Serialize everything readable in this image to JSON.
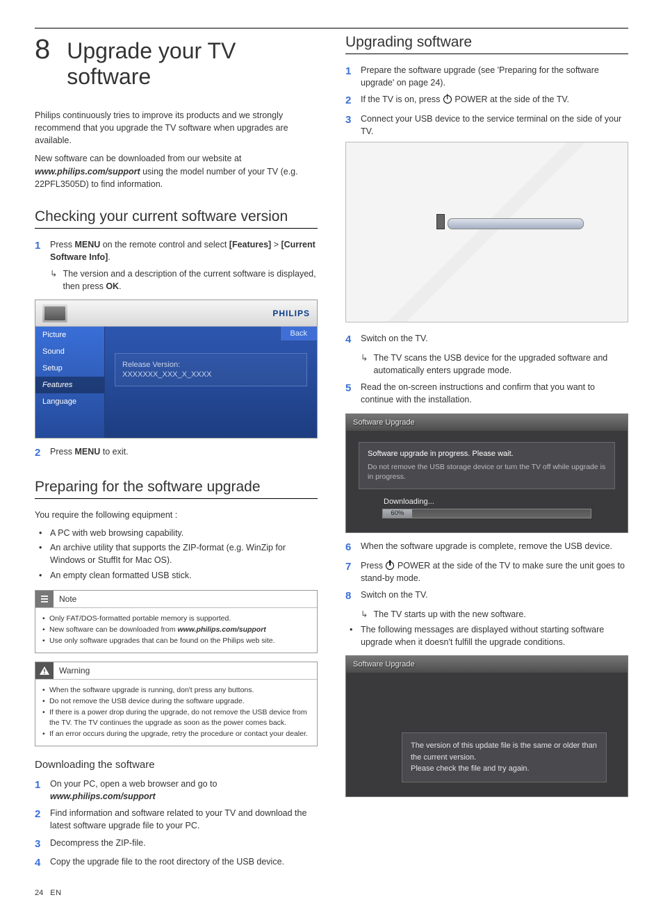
{
  "chapter": {
    "number": "8",
    "title": "Upgrade your TV software"
  },
  "left": {
    "intro1": "Philips continuously tries to improve its products and we strongly recommend that you upgrade the TV software when upgrades are available.",
    "intro2_a": "New software can be downloaded from our website at ",
    "intro2_url": "www.philips.com/support",
    "intro2_b": " using the model number of your TV (e.g. 22PFL3505D) to find information.",
    "sec1": {
      "heading": "Checking your current software version",
      "step1_a": "Press ",
      "step1_menu": "MENU",
      "step1_b": " on the remote control and select ",
      "step1_feat": "[Features]",
      "step1_gt": " > ",
      "step1_info": "[Current Software Info]",
      "step1_dot": ".",
      "step1_sub_a": "The version and a description of the current software is displayed, then press ",
      "step1_sub_ok": "OK",
      "step1_sub_b": ".",
      "step2_a": "Press ",
      "step2_menu": "MENU",
      "step2_b": " to exit."
    },
    "tvmenu": {
      "brand": "PHILIPS",
      "items": [
        "Picture",
        "Sound",
        "Setup",
        "Features",
        "Language"
      ],
      "back": "Back",
      "release_label": "Release Version:",
      "release_value": "XXXXXXX_XXX_X_XXXX"
    },
    "sec2": {
      "heading": "Preparing for the software upgrade",
      "intro": "You require the following equipment :",
      "bullets": [
        "A PC with web browsing capability.",
        "An archive utility that supports the ZIP-format (e.g. WinZip for Windows or StuffIt for Mac OS).",
        "An empty clean formatted USB stick."
      ],
      "note": {
        "label": "Note",
        "items_a": "Only FAT/DOS-formatted portable memory is supported.",
        "items_b_a": "New software can be downloaded from ",
        "items_b_url": "www.philips.com/support",
        "items_c": "Use only software upgrades that can be found on the Philips web site."
      },
      "warning": {
        "label": "Warning",
        "items": [
          "When the software upgrade is running, don't press any buttons.",
          "Do not remove the USB device during the software upgrade.",
          "If there is a power drop during the upgrade, do not remove the USB device from the TV. The TV continues the upgrade as soon as the power comes back.",
          "If an error occurs during the upgrade, retry the procedure or contact your dealer."
        ]
      },
      "dl_heading": "Downloading the software",
      "dl_step1_a": "On your PC, open a web browser and go to ",
      "dl_step1_url": "www.philips.com/support",
      "dl_step2": "Find information and software related to your TV and download the latest software upgrade file to your PC.",
      "dl_step3": "Decompress the ZIP-file.",
      "dl_step4": "Copy the upgrade file to the root directory of the USB device."
    }
  },
  "right": {
    "heading": "Upgrading software",
    "step1": "Prepare the software upgrade (see 'Preparing for the software upgrade' on page 24).",
    "step2_a": "If the TV is on, press ",
    "step2_b": " POWER at the side of the TV.",
    "step3": "Connect your USB device to the service terminal on the side of your TV.",
    "step4": "Switch on the TV.",
    "step4_sub": "The TV scans the USB device for the upgraded software and automatically enters upgrade mode.",
    "step5": "Read the on-screen instructions and confirm that you want to continue with the installation.",
    "sw_progress": {
      "title": "Software Upgrade",
      "line1": "Software upgrade in progress. Please wait.",
      "line2": "Do not remove the USB storage device or turn the TV off while upgrade is in progress.",
      "dl_label": "Downloading...",
      "percent": "60%"
    },
    "step6": "When the software upgrade is complete, remove the USB device.",
    "step7_a": "Press ",
    "step7_b": " POWER at the side of the TV to make sure the unit goes to stand-by mode.",
    "step8": "Switch on the TV.",
    "step8_sub": "The TV starts up with the new software.",
    "bullet_after": "The following messages are displayed without starting software upgrade when it doesn't fulfill the upgrade conditions.",
    "sw_fail": {
      "title": "Software Upgrade",
      "msg1": "The version of this update file is the same or older than the current version.",
      "msg2": "Please check the file and try again."
    }
  },
  "footer": {
    "page": "24",
    "lang": "EN"
  }
}
